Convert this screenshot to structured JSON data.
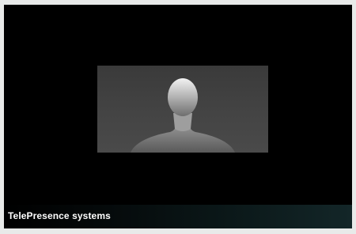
{
  "screen": {
    "background_color": "#000000",
    "placeholder": {
      "icon": "person-silhouette-icon",
      "panel_color": "#444444"
    },
    "footer": {
      "label": "TelePresence systems",
      "text_color": "#ffffff"
    }
  }
}
